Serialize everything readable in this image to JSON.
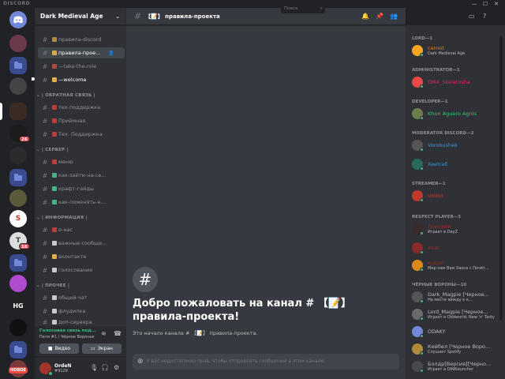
{
  "app": {
    "brand": "DISCORD",
    "window_controls": [
      "—",
      "☐",
      "✕"
    ]
  },
  "rail": {
    "new_badge": "НОВОЕ",
    "badges": [
      "26",
      "16"
    ]
  },
  "server": {
    "name": "Dark Medieval Age"
  },
  "channels": [
    {
      "label": "правила-discord",
      "emoji_color": "#b28c3a"
    },
    {
      "label": "правила-прое...",
      "emoji_color": "#d7a94b"
    },
    {
      "label": "—take-the-role",
      "emoji_color": "#b24a3a"
    },
    {
      "label": "—welcome",
      "emoji_color": "#e0b040"
    },
    {
      "label": "тех-поддержка",
      "emoji_color": "#c23a3a"
    },
    {
      "label": "Приёмная",
      "emoji_color": "#c23a3a"
    },
    {
      "label": "Тех. Поддержка",
      "emoji_color": "#c23a3a"
    },
    {
      "label": "меню",
      "emoji_color": "#c23a3a"
    },
    {
      "label": "как-зайти-на-се...",
      "emoji_color": "#43b581"
    },
    {
      "label": "крафт-гайды",
      "emoji_color": "#43b581"
    },
    {
      "label": "как-поменять-н...",
      "emoji_color": "#43b581"
    },
    {
      "label": "о-нас",
      "emoji_color": "#c23a3a"
    },
    {
      "label": "важные-сообще...",
      "emoji_color": "#c9c9c9"
    },
    {
      "label": "вконтакте",
      "emoji_color": "#e0b040"
    },
    {
      "label": "голосование",
      "emoji_color": "#c9c9c9"
    },
    {
      "label": "общий-чат",
      "emoji_color": "#c9c9c9"
    },
    {
      "label": "флудилка",
      "emoji_color": "#c9c9c9"
    },
    {
      "label": "доп-сервера",
      "emoji_color": "#c9c9c9"
    }
  ],
  "categories": [
    "ОБРАТНАЯ СВЯЗЬ",
    "СЕРВЕР",
    "ИНФОРМАЦИЯ",
    "ПРОЧЕЕ"
  ],
  "voice": {
    "status": "Голосовая связь под...",
    "location": "Пати #1 / Чёрное Воронье",
    "video_label": "Видео",
    "screen_label": "Экран"
  },
  "user": {
    "name": "OrdeN",
    "tag": "#9128"
  },
  "channel_header": {
    "title": "правила-проекта",
    "search_placeholder": "Поиск"
  },
  "welcome": {
    "title": "Добро пожаловать на канал # 【📝】 правила-проекта!",
    "subtitle": "Это начало канала # 【📝】 правила-проекта.",
    "composer_placeholder": "У вас недостаточно прав, чтобы отправлять сообщения в этом канале."
  },
  "members": {
    "roles": [
      "LORD—1",
      "ADMINISTRATOR—1",
      "DEVELOPER—1",
      "MODERATOR DISCORD—2",
      "STREAMER—1",
      "RESPECT PLAYER—3",
      "ЧЁРНЫЕ ВОРОНЫ—10"
    ],
    "list": [
      {
        "name": "сernot",
        "activity": "Dark Medieval Age",
        "color": "#e67e22"
      },
      {
        "name": "DMA_Skeletosha",
        "activity": "",
        "color": "#e91e63"
      },
      {
        "name": "Khun Aguero Agnis",
        "activity": "",
        "color": "#2ecc71"
      },
      {
        "name": "Vorobushek",
        "activity": "",
        "color": "#3498db"
      },
      {
        "name": "Xeetrall",
        "activity": "",
        "color": "#3498db"
      },
      {
        "name": "Volkot",
        "activity": "",
        "color": "#c0392b"
      },
      {
        "name": "Ломовой",
        "activity": "Играет в DayZ",
        "color": "#992d22"
      },
      {
        "name": "Asat",
        "activity": "",
        "color": "#992d22"
      },
      {
        "name": "кудап",
        "activity": "Мир нам Вам Хаоса с Почёт...",
        "color": "#992d22"
      },
      {
        "name": "Dark_Magpie [Черное...",
        "activity": "На месте вижду к к...",
        "color": "#b9bbbe"
      },
      {
        "name": "Lord_Magpie [Черное...",
        "activity": "Играет в Oddworld: New 'n' Tasty",
        "color": "#b9bbbe"
      },
      {
        "name": "ODAKY",
        "activity": "",
        "color": "#b9bbbe"
      },
      {
        "name": "Кейбел [Черное Воро...",
        "activity": "Слушает Spotify",
        "color": "#b9bbbe"
      },
      {
        "name": "Болдр[Версия][Черно...",
        "activity": "Играет в DMAlauncher",
        "color": "#b9bbbe"
      }
    ]
  }
}
